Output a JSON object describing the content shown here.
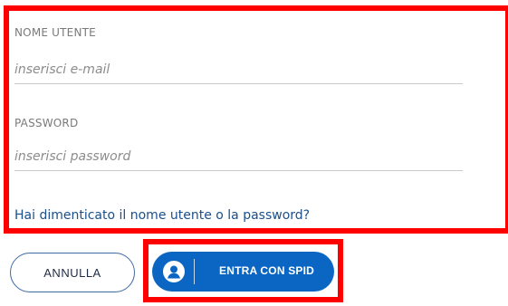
{
  "login_form": {
    "username": {
      "label": "NOME UTENTE",
      "placeholder": "inserisci e-mail",
      "value": ""
    },
    "password": {
      "label": "PASSWORD",
      "placeholder": "inserisci password",
      "value": ""
    },
    "forgot_link": "Hai dimenticato il nome utente o la password?"
  },
  "actions": {
    "cancel_label": "ANNULLA",
    "spid_label": "ENTRA CON SPID",
    "spid_icon": "user-icon"
  },
  "colors": {
    "highlight": "#ff0000",
    "spid_blue": "#0b66c3",
    "link": "#1a4f8b"
  }
}
